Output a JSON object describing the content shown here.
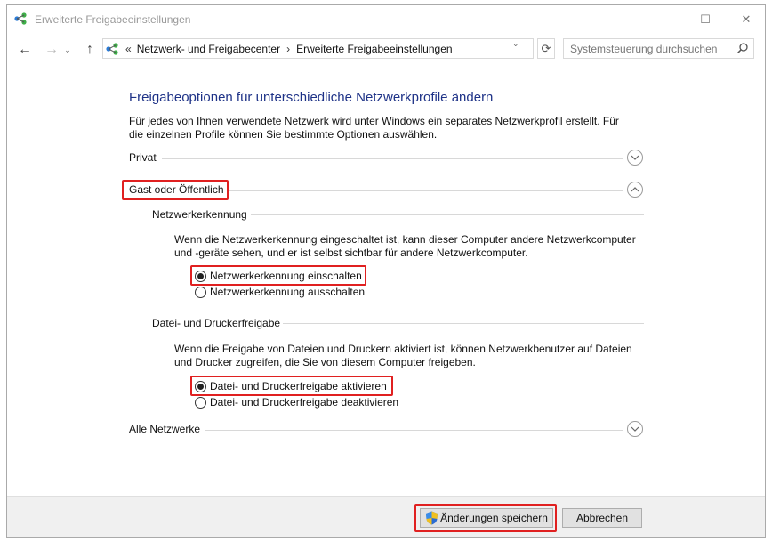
{
  "window": {
    "title": "Erweiterte Freigabeeinstellungen",
    "controls": {
      "minimize": "—",
      "maximize": "☐",
      "close": "✕"
    }
  },
  "nav": {
    "back": "←",
    "forward": "→",
    "recent": "⌄",
    "up": "↑",
    "refresh": "⟳",
    "dropdown": "⌄"
  },
  "address": {
    "prefix": "«",
    "crumbs": [
      "Netzwerk- und Freigabecenter",
      "Erweiterte Freigabeeinstellungen"
    ],
    "separator": "›"
  },
  "search": {
    "placeholder": "Systemsteuerung durchsuchen"
  },
  "page": {
    "title": "Freigabeoptionen für unterschiedliche Netzwerkprofile ändern",
    "intro": "Für jedes von Ihnen verwendete Netzwerk wird unter Windows ein separates Netzwerkprofil erstellt. Für die einzelnen Profile können Sie bestimmte Optionen auswählen."
  },
  "profiles": {
    "private": {
      "label": "Privat",
      "expanded": false
    },
    "guest": {
      "label": "Gast oder Öffentlich",
      "expanded": true
    },
    "all": {
      "label": "Alle Netzwerke",
      "expanded": false
    }
  },
  "discovery": {
    "heading": "Netzwerkerkennung",
    "description": "Wenn die Netzwerkerkennung eingeschaltet ist, kann dieser Computer andere Netzwerkcomputer und -geräte sehen, und er ist selbst sichtbar für andere Netzwerkcomputer.",
    "option_on": "Netzwerkerkennung einschalten",
    "option_off": "Netzwerkerkennung ausschalten",
    "selected": "on"
  },
  "sharing": {
    "heading": "Datei- und Druckerfreigabe",
    "description": "Wenn die Freigabe von Dateien und Druckern aktiviert ist, können Netzwerkbenutzer auf Dateien und Drucker zugreifen, die Sie von diesem Computer freigeben.",
    "option_on": "Datei- und Druckerfreigabe aktivieren",
    "option_off": "Datei- und Druckerfreigabe deaktivieren",
    "selected": "on"
  },
  "footer": {
    "save_label": "Änderungen speichern",
    "cancel_label": "Abbrechen"
  },
  "colors": {
    "title_blue": "#1e3287",
    "highlight_red": "#e02020",
    "footer_bg": "#f0f0f0"
  },
  "icons": {
    "title": "network-icon",
    "address": "network-icon",
    "search": "search-icon",
    "save": "uac-shield-icon",
    "expand": "chevron-down-icon",
    "collapse": "chevron-up-icon"
  }
}
